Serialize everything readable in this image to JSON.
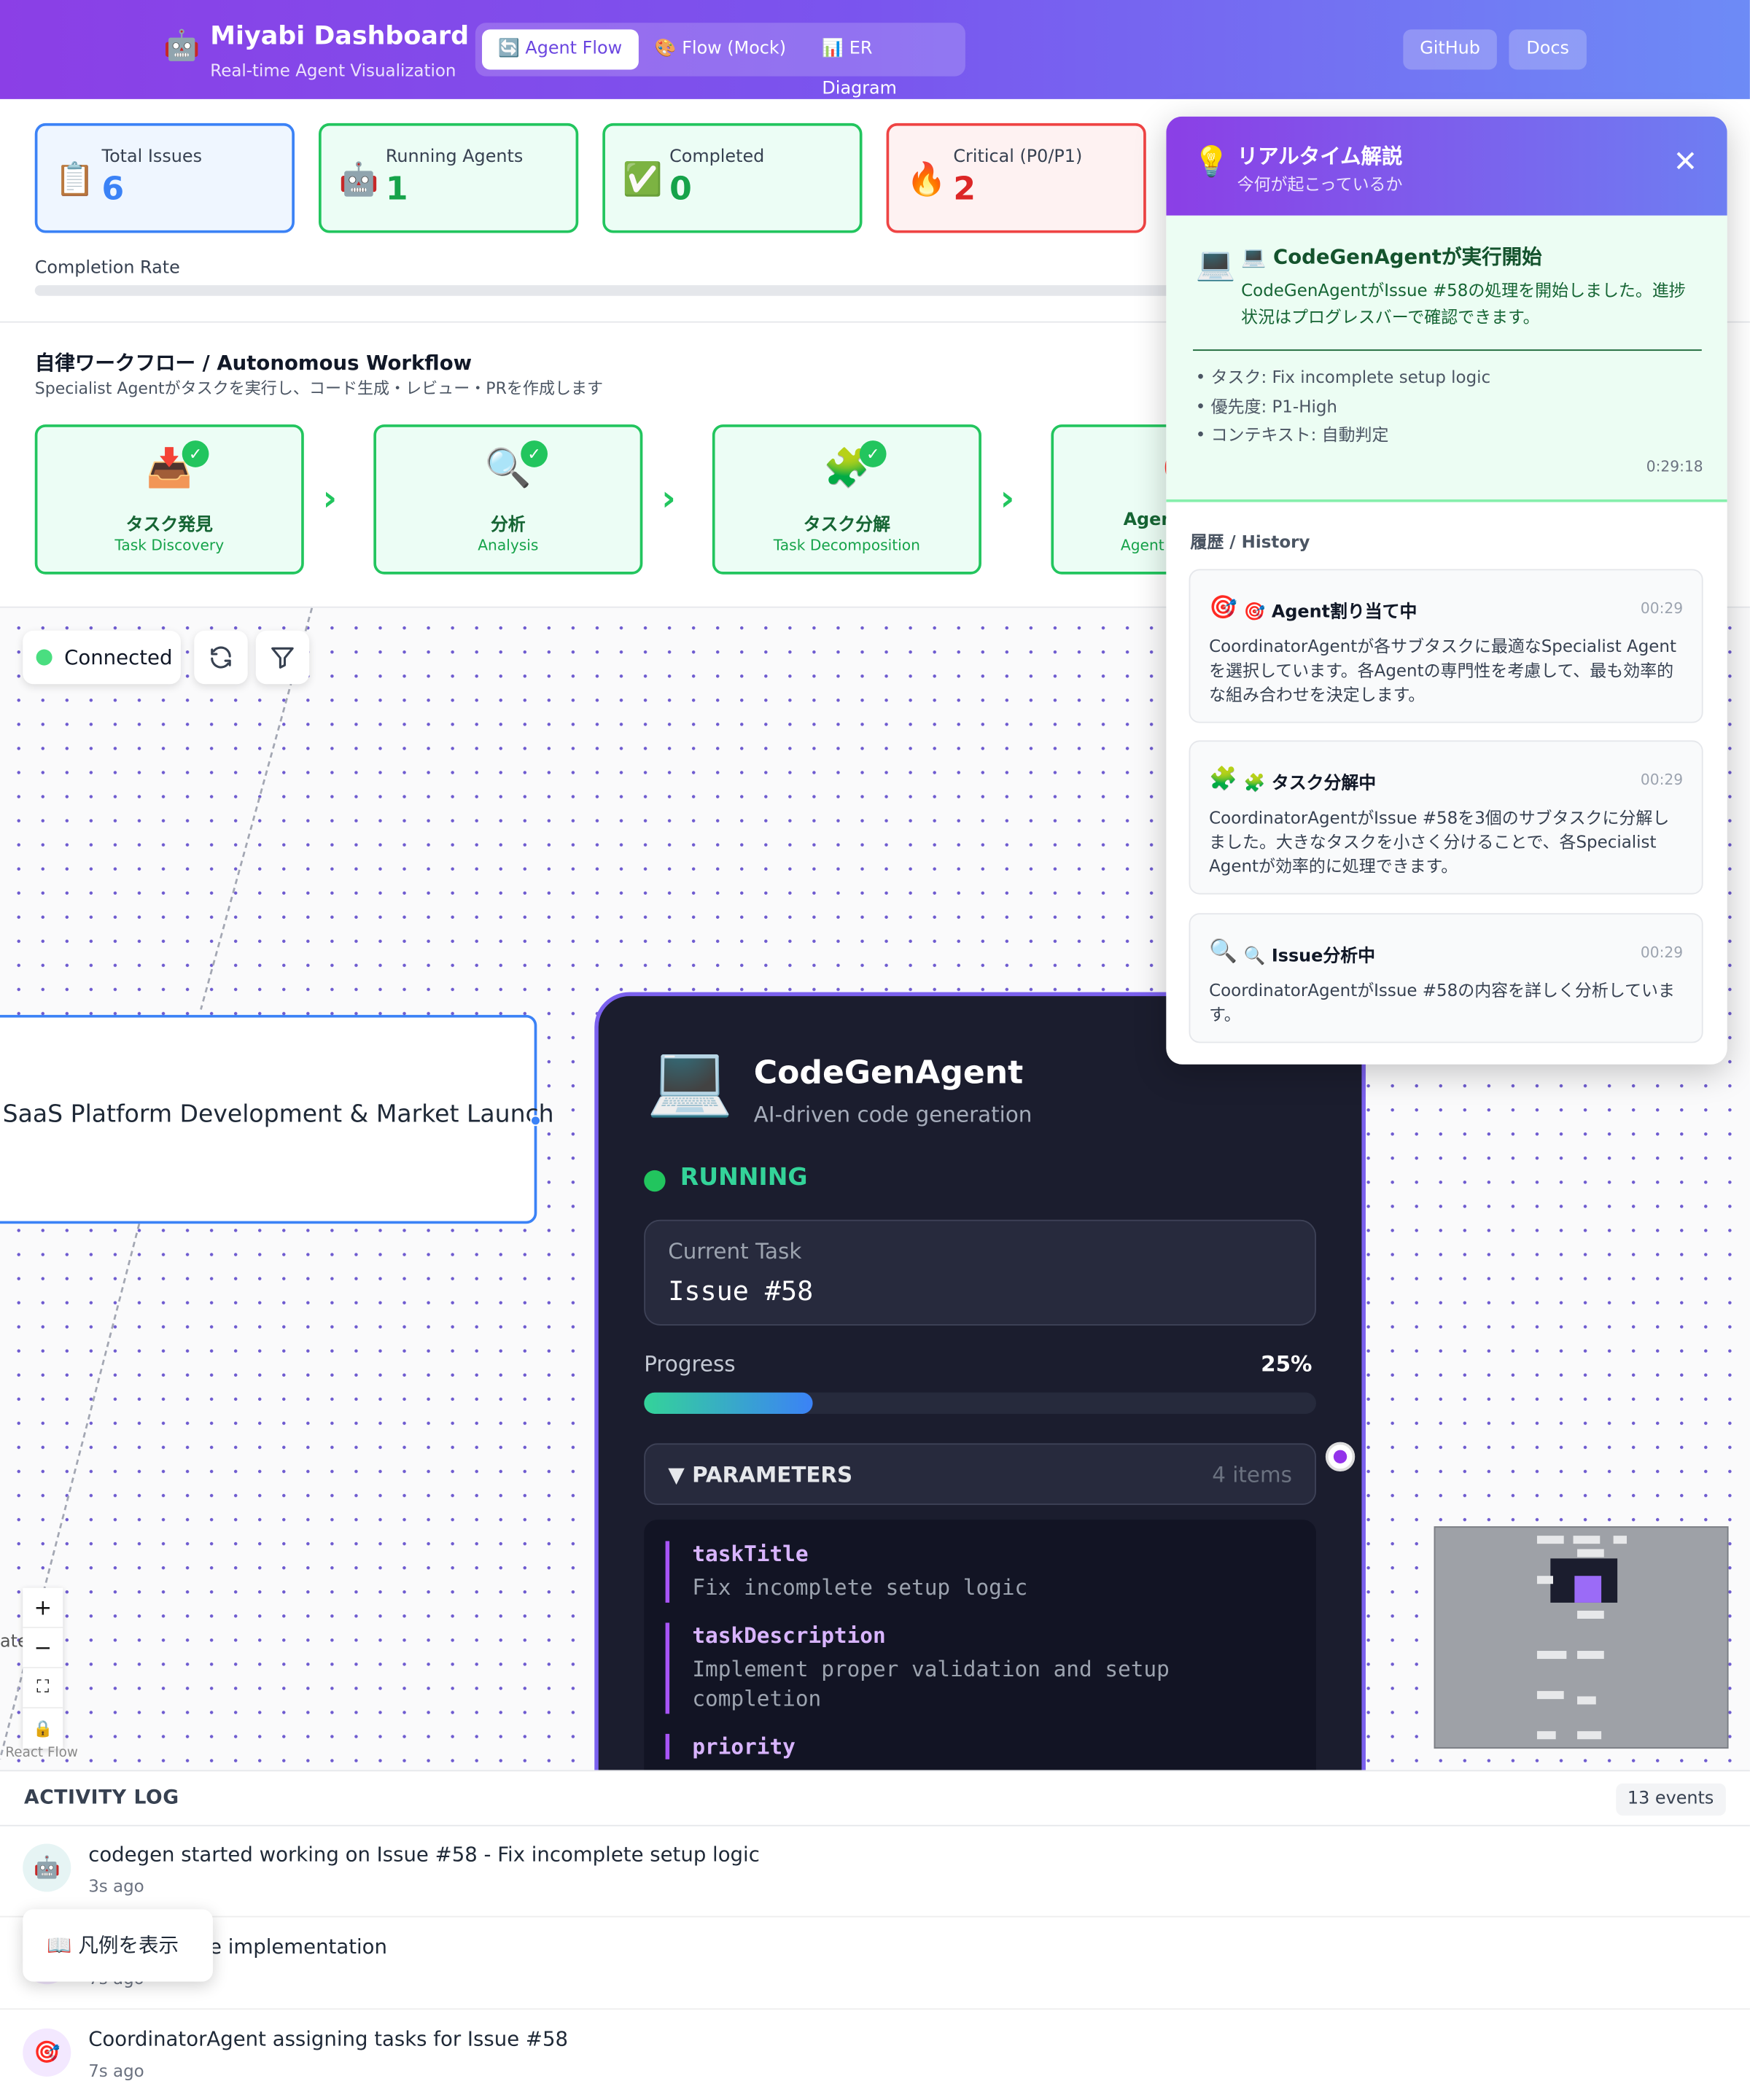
{
  "header": {
    "logo_icon": "🤖",
    "title": "Miyabi Dashboard",
    "subtitle": "Real-time Agent Visualization",
    "tabs": [
      {
        "label": "🔄 Agent Flow",
        "active": true
      },
      {
        "label": "🎨 Flow (Mock)",
        "active": false
      },
      {
        "label": "📊 ER Diagram",
        "active": false
      }
    ],
    "github_label": "GitHub",
    "docs_label": "Docs"
  },
  "stats": {
    "total_issues": {
      "label": "Total Issues",
      "value": "6",
      "icon": "📋",
      "color": "#3b82f6"
    },
    "running_agents": {
      "label": "Running Agents",
      "value": "1",
      "icon": "🤖",
      "color": "#22c55e"
    },
    "completed": {
      "label": "Completed",
      "value": "0",
      "icon": "✅",
      "color": "#22c55e"
    },
    "critical": {
      "label": "Critical (P0/P1)",
      "value": "2",
      "icon": "🔥",
      "color": "#ef4444"
    },
    "completion_rate_label": "Completion Rate",
    "completion_rate": 0
  },
  "workflow": {
    "title": "自律ワークフロー / Autonomous Workflow",
    "subtitle": "Specialist Agentがタスクを実行し、コード生成・レビュー・PRを作成します",
    "steps": [
      {
        "icon": "📥",
        "jp": "タスク発見",
        "en": "Task Discovery",
        "done": true
      },
      {
        "icon": "🔍",
        "jp": "分析",
        "en": "Analysis",
        "done": true
      },
      {
        "icon": "🧩",
        "jp": "タスク分解",
        "en": "Task Decomposition",
        "done": true
      },
      {
        "icon": "🎯",
        "jp": "Agen",
        "en": "Agent",
        "done": false
      }
    ]
  },
  "canvas": {
    "connection_status": "Connected",
    "refresh_icon": "refresh-icon",
    "filter_icon": "filter-icon",
    "project_node_label": "SaaS Platform Development & Market Launch",
    "zoom_controls": [
      "+",
      "−",
      "⛶",
      "🔒"
    ],
    "partial_label": "ate",
    "attribution": "React Flow"
  },
  "agent_node": {
    "icon": "💻",
    "name": "CodeGenAgent",
    "description": "AI-driven code generation",
    "status": "RUNNING",
    "status_color": "#22c55e",
    "current_task_label": "Current Task",
    "current_task": "Issue #58",
    "progress_label": "Progress",
    "progress_text": "25%",
    "progress": 25,
    "parameters_label": "▼ PARAMETERS",
    "parameters_count": "4 items",
    "parameters": [
      {
        "key": "taskTitle",
        "value": "Fix incomplete setup logic"
      },
      {
        "key": "taskDescription",
        "value": "Implement proper validation and setup completion"
      },
      {
        "key": "priority",
        "value": ""
      }
    ]
  },
  "panel": {
    "icon": "💡",
    "title": "リアルタイム解説",
    "subtitle": "今何が起こっているか",
    "close_icon": "close-icon",
    "current": {
      "icon": "💻",
      "title": "💻 CodeGenAgentが実行開始",
      "description": "CodeGenAgentがIssue #58の処理を開始しました。進捗状況はプログレスバーで確認できます。",
      "bullets": [
        "タスク: Fix incomplete setup logic",
        "優先度: P1-High",
        "コンテキスト: 自動判定"
      ],
      "time": "0:29:18"
    },
    "history_title": "履歴 / History",
    "history": [
      {
        "icon": "🎯",
        "title": "🎯 Agent割り当て中",
        "time": "00:29",
        "description": "CoordinatorAgentが各サブタスクに最適なSpecialist Agentを選択しています。各Agentの専門性を考慮して、最も効率的な組み合わせを決定します。"
      },
      {
        "icon": "🧩",
        "title": "🧩 タスク分解中",
        "time": "00:29",
        "description": "CoordinatorAgentがIssue #58を3個のサブタスクに分解しました。大きなタスクを小さく分けることで、各Specialist Agentが効率的に処理できます。"
      },
      {
        "icon": "🔍",
        "title": "🔍 Issue分析中",
        "time": "00:29",
        "description": "CoordinatorAgentがIssue #58の内容を詳しく分析しています。"
      }
    ]
  },
  "activity_log": {
    "title": "ACTIVITY LOG",
    "count": "13 events",
    "entries": [
      {
        "icon": "🤖",
        "message": "codegen started working on Issue #58 - Fix incomplete setup logic",
        "time": "3s ago"
      },
      {
        "icon": "🎯",
        "message": "Best for code implementation",
        "time": "7s ago"
      },
      {
        "icon": "🎯",
        "message": "CoordinatorAgent assigning tasks for Issue #58",
        "time": "7s ago"
      }
    ]
  },
  "legend_button": {
    "icon": "📖",
    "label": "凡例を表示"
  }
}
